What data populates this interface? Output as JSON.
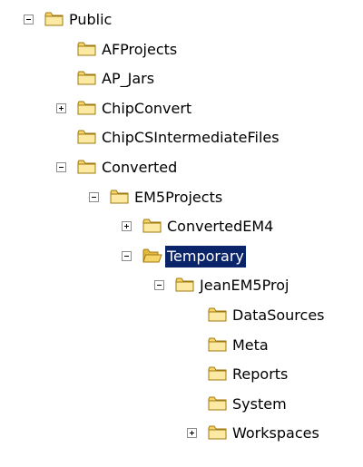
{
  "tree": {
    "folder_icon_color": "#f5d46a",
    "selection_color": "#0a246a",
    "nodes": [
      {
        "label": "Public",
        "depth": 0,
        "toggle": "minus",
        "icon": "folder-icon"
      },
      {
        "label": "AFProjects",
        "depth": 1,
        "toggle": "none",
        "icon": "folder-icon"
      },
      {
        "label": "AP_Jars",
        "depth": 1,
        "toggle": "none",
        "icon": "folder-icon"
      },
      {
        "label": "ChipConvert",
        "depth": 1,
        "toggle": "plus",
        "icon": "folder-icon"
      },
      {
        "label": "ChipCSIntermediateFiles",
        "depth": 1,
        "toggle": "none",
        "icon": "folder-icon"
      },
      {
        "label": "Converted",
        "depth": 1,
        "toggle": "minus",
        "icon": "folder-icon"
      },
      {
        "label": "EM5Projects",
        "depth": 2,
        "toggle": "minus",
        "icon": "folder-icon"
      },
      {
        "label": "ConvertedEM4",
        "depth": 3,
        "toggle": "plus",
        "icon": "folder-icon"
      },
      {
        "label": "Temporary",
        "depth": 3,
        "toggle": "minus",
        "icon": "open-folder-icon",
        "selected": true
      },
      {
        "label": "JeanEM5Proj",
        "depth": 4,
        "toggle": "minus",
        "icon": "folder-icon"
      },
      {
        "label": "DataSources",
        "depth": 5,
        "toggle": "none",
        "icon": "folder-icon"
      },
      {
        "label": "Meta",
        "depth": 5,
        "toggle": "none",
        "icon": "folder-icon"
      },
      {
        "label": "Reports",
        "depth": 5,
        "toggle": "none",
        "icon": "folder-icon"
      },
      {
        "label": "System",
        "depth": 5,
        "toggle": "none",
        "icon": "folder-icon"
      },
      {
        "label": "Workspaces",
        "depth": 5,
        "toggle": "plus",
        "icon": "folder-icon"
      }
    ]
  }
}
